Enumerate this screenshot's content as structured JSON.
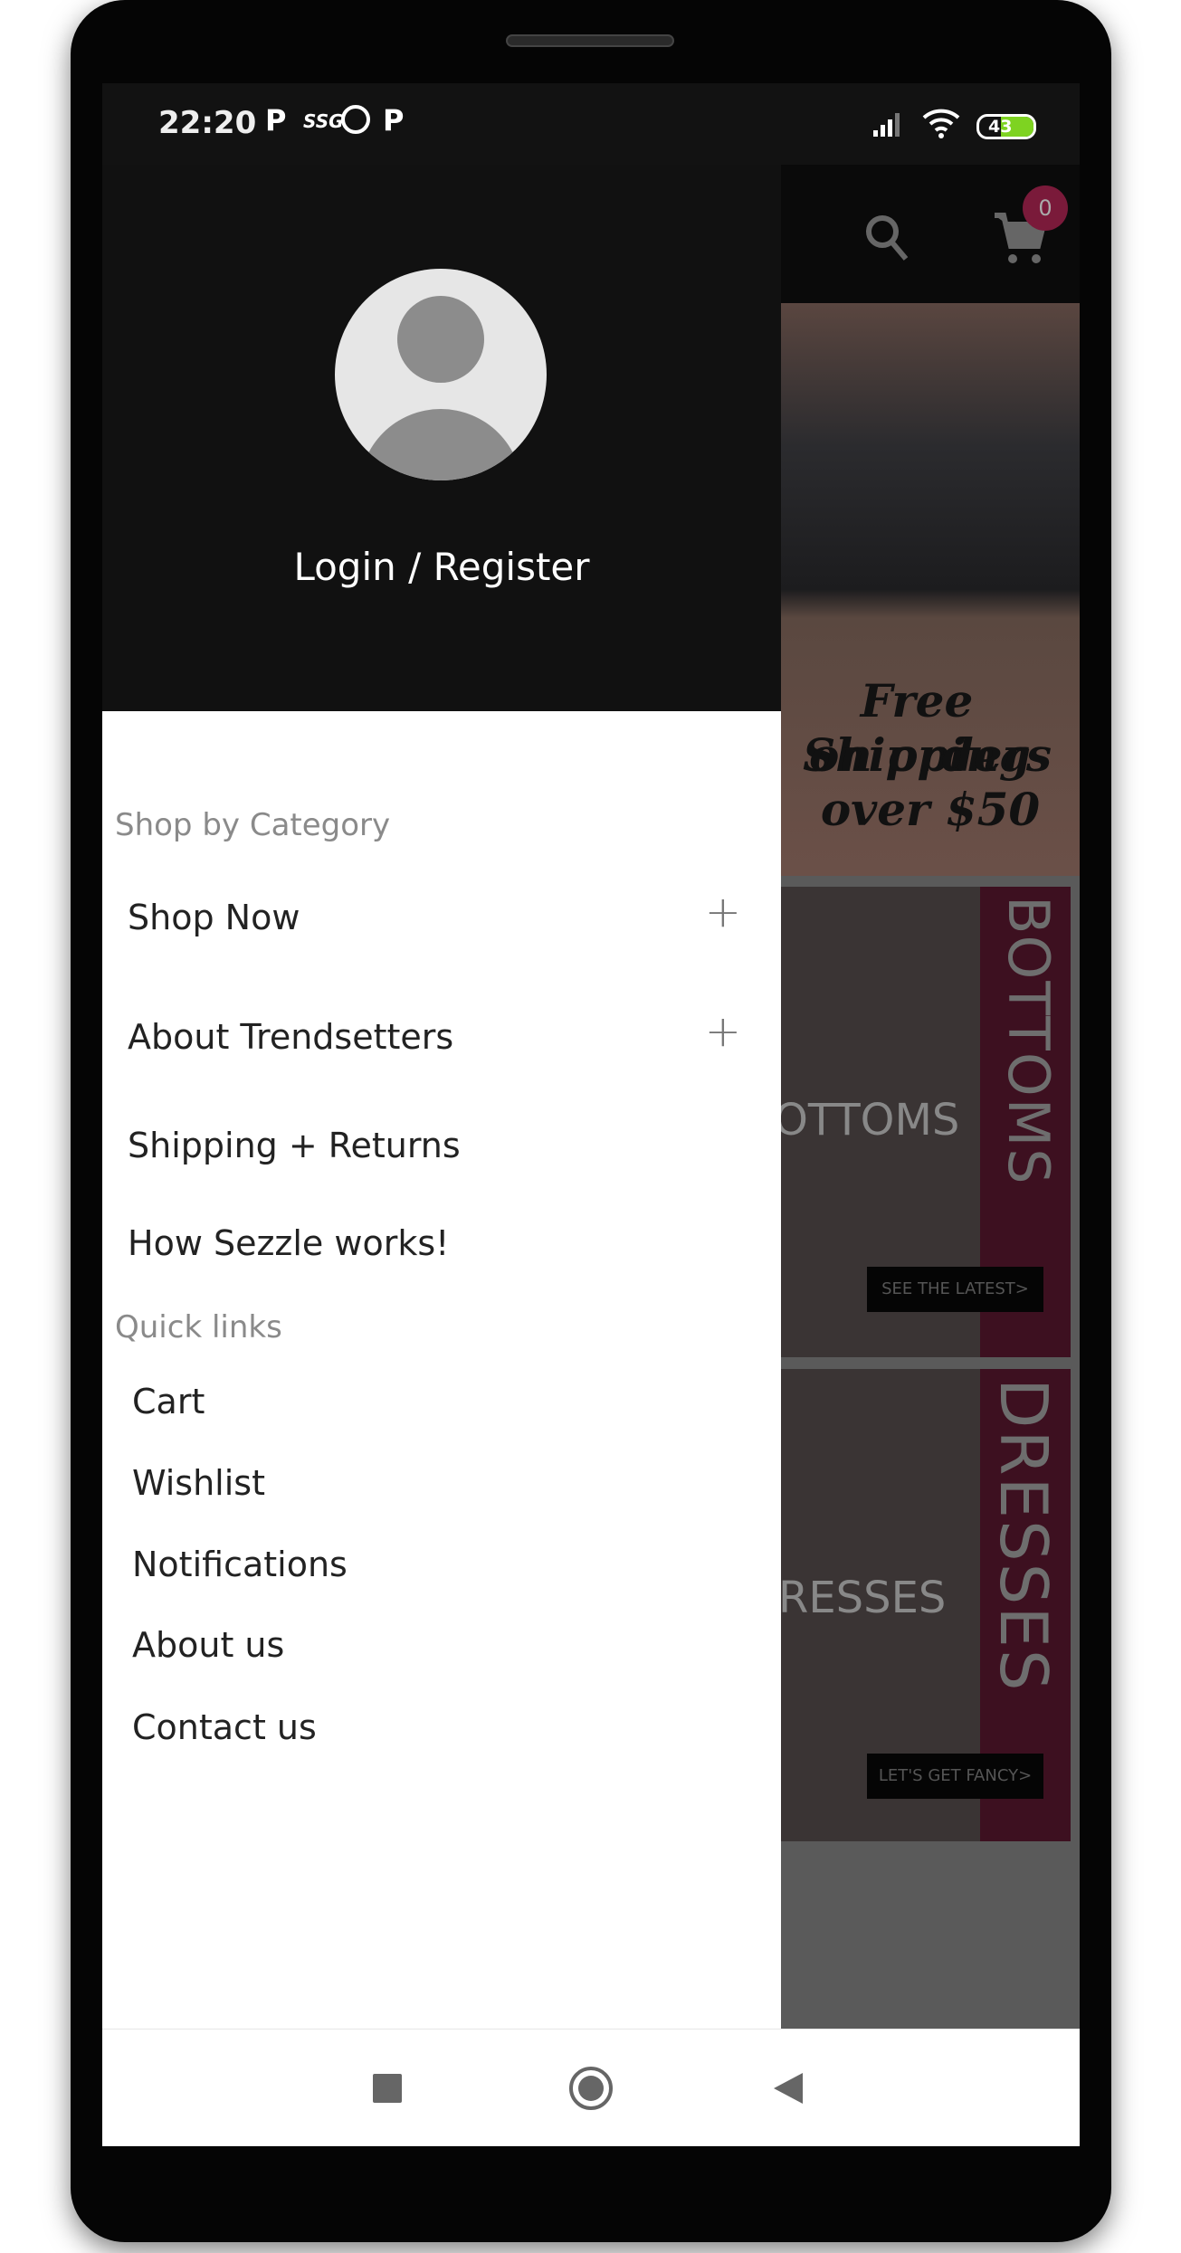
{
  "status_bar": {
    "time": "22:20",
    "left_icons": [
      "p-icon",
      "ssg-icon",
      "whatsapp-icon",
      "p-icon"
    ],
    "ssg_label": "SSG",
    "battery": "43",
    "battery_color": "#7ed321"
  },
  "toolbar": {
    "cart_count": "0",
    "badge_color": "#7a1a3a"
  },
  "banner": {
    "line1": "Free Shipping",
    "line2": "on orders",
    "line3": "over $50"
  },
  "cards": [
    {
      "vertical": "BOTTOMS",
      "title": "BOTTOMS",
      "cta": "SEE THE LATEST>"
    },
    {
      "vertical": "DRESSES",
      "title": "DRESSES",
      "cta": "LET'S GET FANCY>"
    }
  ],
  "drawer": {
    "login": "Login / Register",
    "section_category": "Shop by Category",
    "categories": [
      {
        "label": "Shop Now",
        "expandable": true
      },
      {
        "label": "About Trendsetters",
        "expandable": true
      },
      {
        "label": "Shipping + Returns",
        "expandable": false
      },
      {
        "label": "How Sezzle works!",
        "expandable": false
      }
    ],
    "section_quick": "Quick links",
    "quick_links": [
      "Cart",
      "Wishlist",
      "Notifications",
      "About us",
      "Contact us"
    ]
  }
}
